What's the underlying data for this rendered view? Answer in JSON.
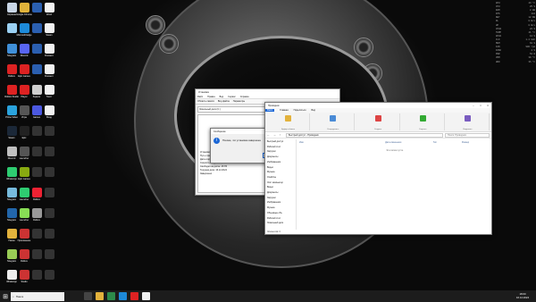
{
  "desktop": {
    "icons": [
      {
        "label": "Корзина",
        "c": "#c9d6e6"
      },
      {
        "label": "Google Chrome",
        "c": "#e0b23a"
      },
      {
        "label": "",
        "c": "#2b5fb0"
      },
      {
        "label": "Word",
        "c": "#f2f2f2"
      },
      {
        "label": "",
        "c": "#9bd1f3"
      },
      {
        "label": "Microsoft Edge",
        "c": "#1d8ad9"
      },
      {
        "label": "",
        "c": "#2b5fb0"
      },
      {
        "label": "Steam",
        "c": "#f2f2f2"
      },
      {
        "label": "Telegram",
        "c": "#3f8fd8"
      },
      {
        "label": "Discord",
        "c": "#5865f2"
      },
      {
        "label": "",
        "c": "#2b5fb0"
      },
      {
        "label": "Блокнот",
        "c": "#f2f2f2"
      },
      {
        "label": "Roblox",
        "c": "#d22"
      },
      {
        "label": "Epic Games",
        "c": "#d22"
      },
      {
        "label": "",
        "c": "#2b5fb0"
      },
      {
        "label": "Блокнот",
        "c": "#f2f2f2"
      },
      {
        "label": "Roblox Studio",
        "c": "#d22"
      },
      {
        "label": "Player",
        "c": "#d22"
      },
      {
        "label": "Задачи",
        "c": "#cfcfcf"
      },
      {
        "label": "Текст",
        "c": "#f2f2f2"
      },
      {
        "label": "Prime Video",
        "c": "#2aa3dd"
      },
      {
        "label": "Игра",
        "c": "#555"
      },
      {
        "label": "Games",
        "c": "#4b58e0"
      },
      {
        "label": "Вход",
        "c": "#f2f2f2"
      },
      {
        "label": "Steam",
        "c": "#1b2838"
      },
      {
        "label": "Epic",
        "c": "#222"
      },
      {
        "label": "",
        "c": "#333"
      },
      {
        "label": "",
        "c": "#333"
      },
      {
        "label": "Discord",
        "c": "#c0c0c0"
      },
      {
        "label": "Launcher",
        "c": "#555"
      },
      {
        "label": "",
        "c": "#333"
      },
      {
        "label": "",
        "c": "#333"
      },
      {
        "label": "WhatsApp",
        "c": "#2ecc71"
      },
      {
        "label": "Epic Games",
        "c": "#8a1"
      },
      {
        "label": "",
        "c": "#333"
      },
      {
        "label": "",
        "c": "#333"
      },
      {
        "label": "Telegram",
        "c": "#7bd"
      },
      {
        "label": "Launcher",
        "c": "#2ecc71"
      },
      {
        "label": "Roblox",
        "c": "#e23"
      },
      {
        "label": "",
        "c": "#333"
      },
      {
        "label": "Telegram",
        "c": "#26a"
      },
      {
        "label": "Launcher",
        "c": "#8d5"
      },
      {
        "label": "Roblox",
        "c": "#999"
      },
      {
        "label": "",
        "c": "#333"
      },
      {
        "label": "Папка",
        "c": "#e3b23c"
      },
      {
        "label": "Приложение",
        "c": "#c33"
      },
      {
        "label": "",
        "c": "#333"
      },
      {
        "label": "",
        "c": "#333"
      },
      {
        "label": "Telegram",
        "c": "#9c5"
      },
      {
        "label": "Roblox",
        "c": "#c33"
      },
      {
        "label": "",
        "c": "#333"
      },
      {
        "label": "",
        "c": "#333"
      },
      {
        "label": "WhatsApp",
        "c": "#eee"
      },
      {
        "label": "Studio",
        "c": "#c33"
      },
      {
        "label": "",
        "c": "#333"
      },
      {
        "label": "",
        "c": "#333"
      }
    ]
  },
  "widget": {
    "rows": [
      [
        "GPU",
        "43 °C"
      ],
      [
        "CPU",
        "25 %"
      ],
      [
        "RAM",
        "8 GB"
      ],
      [
        "FPS",
        "144"
      ],
      [
        "NET",
        "12 KB"
      ],
      [
        "DL",
        "0 B/s"
      ],
      [
        "UP",
        "0 B/s"
      ],
      [
        "CPU2",
        "22 %"
      ],
      [
        "TEMP",
        "41 °C"
      ],
      [
        "GPU2",
        "12 %"
      ],
      [
        "CLK",
        "1.2 GHz"
      ],
      [
        "MEM",
        "62 %"
      ],
      [
        "FAN",
        "900 rpm"
      ],
      [
        "DISK",
        "4 %"
      ],
      [
        "PWR",
        "52 W"
      ],
      [
        "VRM",
        "39 °C"
      ],
      [
        "HDD",
        "36 °C"
      ]
    ]
  },
  "install": {
    "title": "Установка",
    "menu": [
      "Файл",
      "Правка",
      "Вид",
      "Сервис",
      "Справка"
    ],
    "tabs": [
      "Область памяти",
      "Вид файла",
      "Параметры"
    ],
    "field": "Локальный диск (C:)",
    "log": [
      "Установка приложения по умолчанию",
      "Путь к файлу: C:\\Users\\User\\AppData",
      "Дата и время: 16.12.2024",
      "Скорость загрузки: 1,8 МБ/с",
      "Свободно на диске: 48 ГБ",
      "Текущая дата: 16.12.2024",
      "Завершено"
    ]
  },
  "dialog": {
    "title": "Сообщение",
    "text": "Похоже, что установка завершена",
    "ok": "ОК"
  },
  "explorer": {
    "title": "Проводник",
    "ribbon_tabs": [
      "Файл",
      "Главная",
      "Поделиться",
      "Вид"
    ],
    "ribbon_groups": [
      "Буфер обмена",
      "Упорядочить",
      "Создать",
      "Открыть",
      "Выделить"
    ],
    "address": "Быстрый доступ › Проводник",
    "search": "Поиск: Проводник",
    "columns": [
      "Имя",
      "Дата изменения",
      "Тип",
      "Размер"
    ],
    "empty": "Эта папка пуста.",
    "nav": [
      "Быстрый доступ",
      "Рабочий стол",
      "Загрузки",
      "Документы",
      "Изображения",
      "Видео",
      "Музыка",
      "OneDrive",
      "Этот компьютер",
      "Видео",
      "Документы",
      "Загрузки",
      "Изображения",
      "Музыка",
      "Объемные объ",
      "Рабочий стол",
      "Локальный диск"
    ],
    "status": "Элементов: 0"
  },
  "taskbar": {
    "search": "Поиск",
    "time": "18:00",
    "date": "16.12.2024"
  }
}
